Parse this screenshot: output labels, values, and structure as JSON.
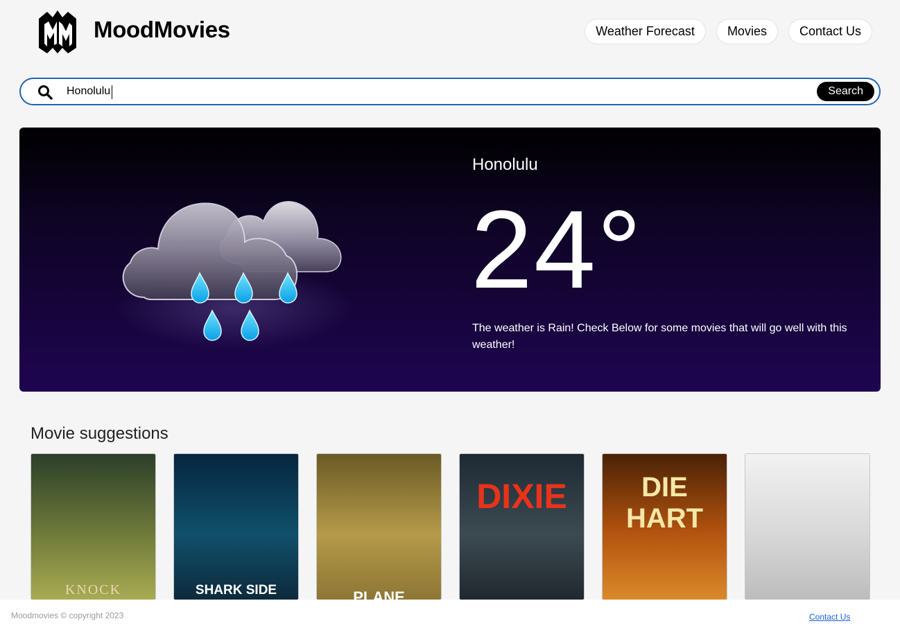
{
  "header": {
    "brand": "MoodMovies",
    "logo_icon": "mm-logo-icon",
    "nav": [
      "Weather Forecast",
      "Movies",
      "Contact Us"
    ]
  },
  "search": {
    "icon": "search-icon",
    "value": "Honolulu",
    "button_label": "Search",
    "border_color": "#1f63b8"
  },
  "weather": {
    "icon": "rain-cloud-icon",
    "city": "Honolulu",
    "temperature": "24°",
    "description": "The weather is Rain! Check Below for some movies that will go well with this weather!"
  },
  "movies": {
    "title": "Movie suggestions",
    "posters": [
      {
        "title": "KNOCK",
        "colors": [
          "#2c3f2a",
          "#6f7a3a",
          "#a8ab53"
        ],
        "title_color": "#e8d7b0"
      },
      {
        "title": "SHARK SIDE",
        "colors": [
          "#06263f",
          "#10506a",
          "#0d2a3c"
        ],
        "title_color": "#ffffff"
      },
      {
        "title": "PLANE",
        "colors": [
          "#6a5a25",
          "#b59a4a",
          "#8d7636"
        ],
        "title_color": "#ffffff"
      },
      {
        "title": "DIXIE",
        "colors": [
          "#1e2a33",
          "#3c4a52",
          "#20282e"
        ],
        "title_color": "#e8331b"
      },
      {
        "title": "DIE HART",
        "colors": [
          "#4a2206",
          "#b45410",
          "#d98a2b"
        ],
        "title_color": "#f6e7a6"
      },
      {
        "title": "",
        "colors": [
          "#f2f2f2",
          "#d8d8d8",
          "#bcbcbc"
        ],
        "title_color": "#c81818"
      }
    ]
  },
  "footer": {
    "copyright": "Moodmovies © copyright 2023",
    "link": "Contact Us"
  }
}
